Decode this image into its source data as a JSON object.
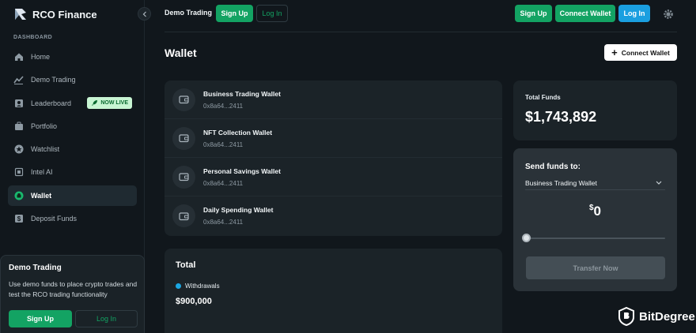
{
  "brand": {
    "name": "RCO Finance"
  },
  "sidebar": {
    "section_label": "DASHBOARD",
    "items": [
      {
        "label": "Home",
        "icon": "home-icon"
      },
      {
        "label": "Demo Trading",
        "icon": "chart-line-icon"
      },
      {
        "label": "Leaderboard",
        "icon": "leaderboard-icon",
        "badge": "NOW LIVE"
      },
      {
        "label": "Portfolio",
        "icon": "portfolio-icon"
      },
      {
        "label": "Watchlist",
        "icon": "star-icon"
      },
      {
        "label": "Intel AI",
        "icon": "ai-chip-icon"
      },
      {
        "label": "Wallet",
        "icon": "wallet-icon",
        "active": true
      },
      {
        "label": "Deposit Funds",
        "icon": "dollar-icon"
      }
    ],
    "demo_card": {
      "title": "Demo Trading",
      "description": "Use demo funds to place crypto trades and test the RCO trading functionality",
      "signup": "Sign Up",
      "login": "Log In"
    }
  },
  "topbar": {
    "demo_label": "Demo Trading",
    "signup": "Sign Up",
    "login": "Log In",
    "right_signup": "Sign Up",
    "connect_wallet": "Connect Wallet",
    "right_login": "Log In"
  },
  "main": {
    "title": "Wallet",
    "connect_wallet": "Connect Wallet",
    "wallets": [
      {
        "name": "Business Trading Wallet",
        "address": "0x8a64...2411"
      },
      {
        "name": "NFT Collection Wallet",
        "address": "0x8a64...2411"
      },
      {
        "name": "Personal Savings Wallet",
        "address": "0x8a64...2411"
      },
      {
        "name": "Daily Spending Wallet",
        "address": "0x8a64...2411"
      }
    ],
    "total": {
      "title": "Total",
      "legend_label": "Withdrawals",
      "value": "$900,000"
    },
    "funds": {
      "label": "Total Funds",
      "value": "$1,743,892"
    },
    "send": {
      "label": "Send funds to:",
      "selected": "Business Trading Wallet",
      "currency": "$",
      "amount": "0",
      "slider_value": 0,
      "transfer": "Transfer Now"
    }
  },
  "watermark": {
    "text": "BitDegree"
  },
  "colors": {
    "green": "#13a363",
    "blue": "#1a9fe0",
    "bg": "#11171c",
    "card": "#1b2328"
  }
}
